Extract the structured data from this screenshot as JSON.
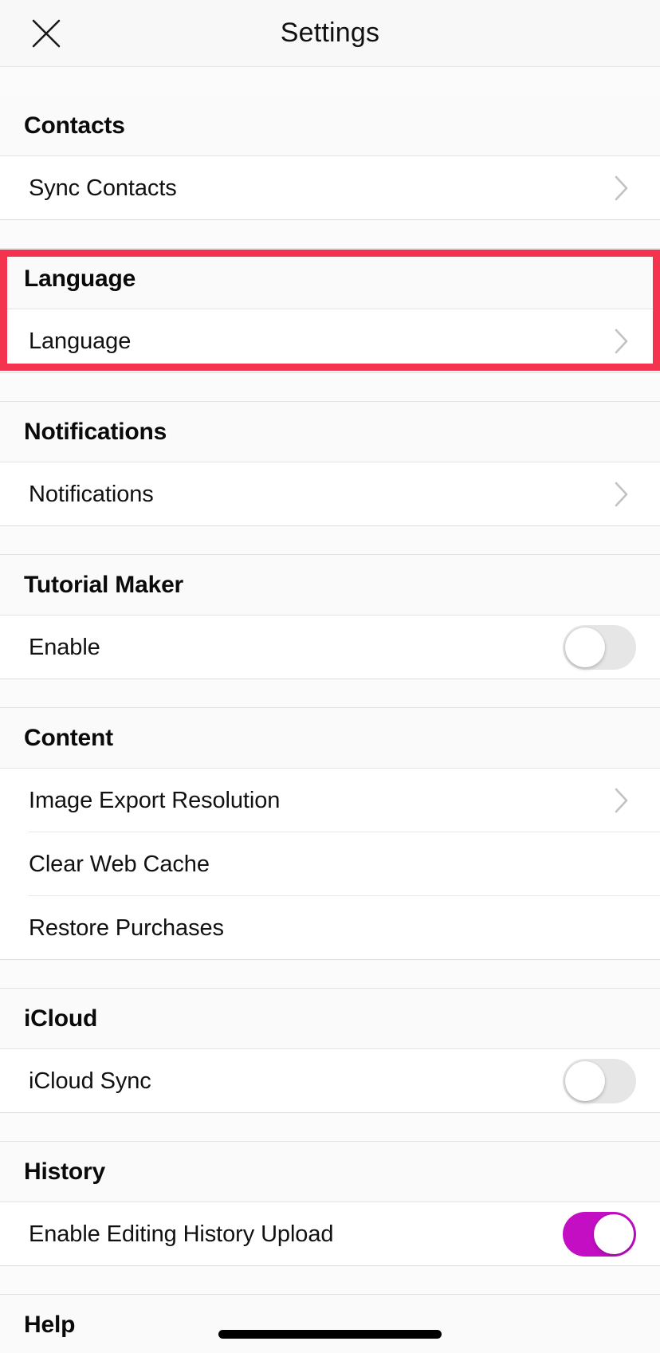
{
  "navbar": {
    "close_icon": "close-icon",
    "title": "Settings"
  },
  "colors": {
    "highlight_border": "#f4334f",
    "toggle_on": "#c40ec4",
    "toggle_off_track": "#e6e6e6",
    "chevron": "#c2c2c2",
    "section_header_bg": "#fafafa",
    "row_bg": "#ffffff",
    "text": "#111111"
  },
  "sections": [
    {
      "id": "contacts",
      "title": "Contacts",
      "highlighted": false,
      "rows": [
        {
          "id": "sync-contacts",
          "label": "Sync Contacts",
          "accessory": "chevron"
        }
      ]
    },
    {
      "id": "language",
      "title": "Language",
      "highlighted": true,
      "rows": [
        {
          "id": "language",
          "label": "Language",
          "accessory": "chevron"
        }
      ]
    },
    {
      "id": "notifications",
      "title": "Notifications",
      "highlighted": false,
      "rows": [
        {
          "id": "notifications",
          "label": "Notifications",
          "accessory": "chevron"
        }
      ]
    },
    {
      "id": "tutorial-maker",
      "title": "Tutorial Maker",
      "highlighted": false,
      "rows": [
        {
          "id": "enable",
          "label": "Enable",
          "accessory": "toggle",
          "toggle_state": "off"
        }
      ]
    },
    {
      "id": "content",
      "title": "Content",
      "highlighted": false,
      "rows": [
        {
          "id": "image-export-resolution",
          "label": "Image Export Resolution",
          "accessory": "chevron"
        },
        {
          "id": "clear-web-cache",
          "label": "Clear Web Cache",
          "accessory": "none"
        },
        {
          "id": "restore-purchases",
          "label": "Restore Purchases",
          "accessory": "none"
        }
      ]
    },
    {
      "id": "icloud",
      "title": "iCloud",
      "highlighted": false,
      "rows": [
        {
          "id": "icloud-sync",
          "label": "iCloud Sync",
          "accessory": "toggle",
          "toggle_state": "off"
        }
      ]
    },
    {
      "id": "history",
      "title": "History",
      "highlighted": false,
      "rows": [
        {
          "id": "enable-editing-history-upload",
          "label": "Enable Editing History Upload",
          "accessory": "toggle",
          "toggle_state": "on"
        }
      ]
    },
    {
      "id": "help",
      "title": "Help",
      "highlighted": false,
      "rows": []
    }
  ]
}
